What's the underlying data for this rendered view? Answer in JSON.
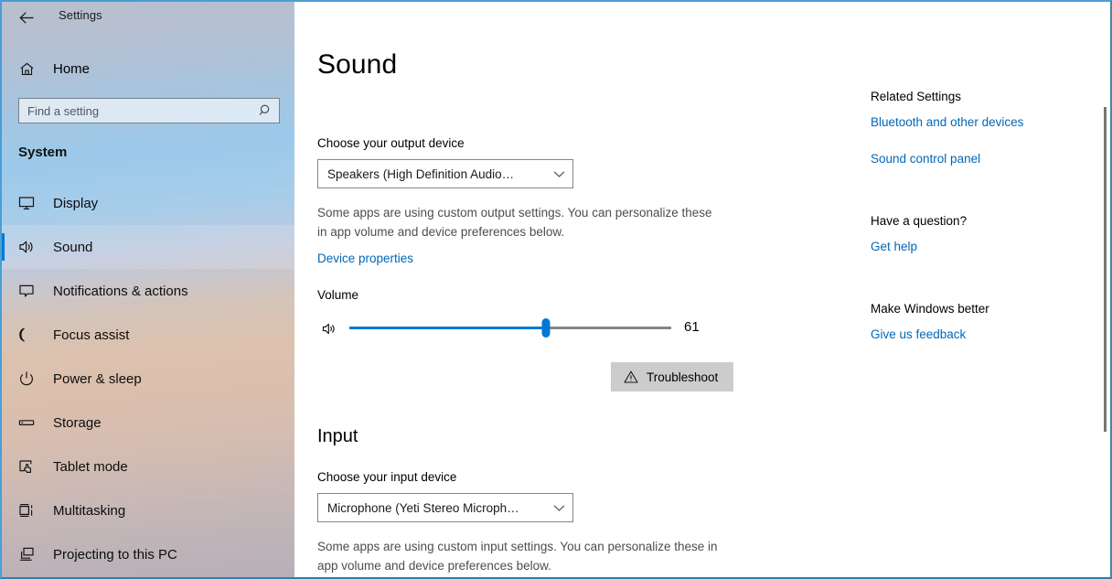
{
  "window": {
    "app_title": "Settings",
    "back_icon": "back-arrow-icon",
    "minimize_label": "—",
    "maximize_label": "☐",
    "close_label": "✕",
    "accent_color": "#0078d7",
    "link_color": "#0067b8"
  },
  "sidebar": {
    "home_label": "Home",
    "search": {
      "placeholder": "Find a setting",
      "value": ""
    },
    "section_title": "System",
    "items": [
      {
        "label": "Display",
        "icon": "monitor-icon",
        "selected": false
      },
      {
        "label": "Sound",
        "icon": "speaker-icon",
        "selected": true
      },
      {
        "label": "Notifications & actions",
        "icon": "notification-icon",
        "selected": false
      },
      {
        "label": "Focus assist",
        "icon": "moon-icon",
        "selected": false
      },
      {
        "label": "Power & sleep",
        "icon": "power-icon",
        "selected": false
      },
      {
        "label": "Storage",
        "icon": "drive-icon",
        "selected": false
      },
      {
        "label": "Tablet mode",
        "icon": "tablet-icon",
        "selected": false
      },
      {
        "label": "Multitasking",
        "icon": "multitasking-icon",
        "selected": false
      },
      {
        "label": "Projecting to this PC",
        "icon": "project-icon",
        "selected": false
      }
    ]
  },
  "main": {
    "page_title": "Sound",
    "output": {
      "label": "Choose your output device",
      "device": "Speakers (High Definition Audio…",
      "note": "Some apps are using custom output settings. You can personalize these in app volume and device preferences below.",
      "device_properties_link": "Device properties",
      "volume_label": "Volume",
      "volume_value": "61",
      "volume_min": "0",
      "volume_max": "100",
      "troubleshoot_label": "Troubleshoot"
    },
    "input": {
      "heading": "Input",
      "label": "Choose your input device",
      "device": "Microphone (Yeti Stereo Microph…",
      "note": "Some apps are using custom input settings. You can personalize these in app volume and device preferences below."
    }
  },
  "right_rail": {
    "related_settings_heading": "Related Settings",
    "related_links": [
      "Bluetooth and other devices",
      "Sound control panel"
    ],
    "question_heading": "Have a question?",
    "question_link": "Get help",
    "feedback_heading": "Make Windows better",
    "feedback_link": "Give us feedback"
  }
}
